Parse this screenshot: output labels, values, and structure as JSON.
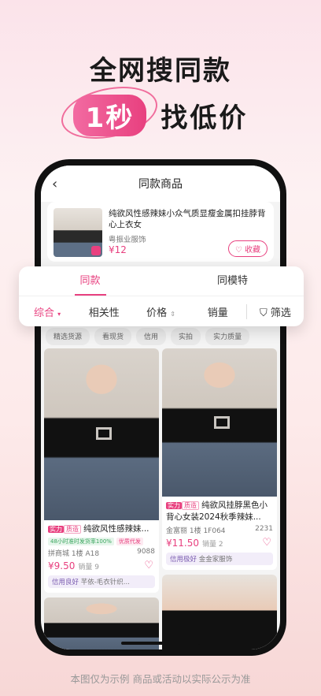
{
  "hero": {
    "title": "全网搜同款",
    "badge": "1秒",
    "subtitle": "找低价"
  },
  "nav": {
    "back_icon": "‹",
    "title": "同款商品"
  },
  "product": {
    "title": "纯欲风性感辣妹小众气质显瘦金属扣挂脖背心上衣女",
    "shop": "粤振业服饰",
    "price": "¥12",
    "collect_label": "♡ 收藏"
  },
  "tabs": [
    {
      "label": "同款",
      "active": true
    },
    {
      "label": "同模特",
      "active": false
    }
  ],
  "sorts": {
    "comprehensive": "综合",
    "relevance": "相关性",
    "price": "价格",
    "sales": "销量",
    "filter": "筛选"
  },
  "chips": [
    "精选货源",
    "看现货",
    "信用",
    "实拍",
    "实力质量"
  ],
  "items": [
    {
      "tag1": "实力",
      "tag2": "质造",
      "title": "纯欲风性感辣妹...",
      "mini_tags": [
        "48小时准时发货率100%",
        "优质代发"
      ],
      "location": "拼商城 1楼 A18",
      "count": "9088",
      "price": "¥9.50",
      "sold": "销量 9",
      "credit": "信用良好",
      "credit_rest": "芊依-毛衣针织..."
    },
    {
      "tag1": "实力",
      "tag2": "质造",
      "title": "纯欲风挂脖黑色小背心女装2024秋季辣妹...",
      "location": "金富丽 1楼 1F064",
      "count": "2231",
      "price": "¥11.50",
      "sold": "销量 2",
      "credit": "信用极好",
      "credit_rest": "金金家服饰"
    }
  ],
  "disclaimer": "本图仅为示例 商品或活动以实际公示为准",
  "colors": {
    "accent": "#e8407f",
    "credit": "#7a5bb0"
  }
}
